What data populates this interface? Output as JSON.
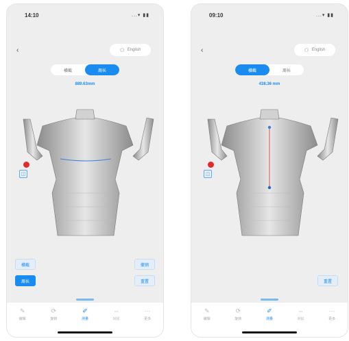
{
  "left_phone": {
    "status_time": "14:10",
    "status_icons": "...▾ ▮▮",
    "english_label": "English",
    "segments": [
      "横截",
      "周长"
    ],
    "active_segment": 1,
    "measurement": "889.63mm",
    "buttons": {
      "left_top": "横截",
      "left_bottom": "周长",
      "right_top": "撤销",
      "right_bottom": "重置"
    }
  },
  "right_phone": {
    "status_time": "09:10",
    "status_icons": "...▾ ▮▮",
    "english_label": "English",
    "segments": [
      "横截",
      "周长"
    ],
    "active_segment": 0,
    "measurement": "438.36 mm",
    "buttons": {
      "right_bottom": "重置"
    }
  },
  "tabs": [
    {
      "icon": "pencil-icon",
      "label": "编辑"
    },
    {
      "icon": "rotate-icon",
      "label": "旋转"
    },
    {
      "icon": "measure-icon",
      "label": "测量"
    },
    {
      "icon": "compare-icon",
      "label": "对比"
    },
    {
      "icon": "more-icon",
      "label": "更多"
    }
  ],
  "colors": {
    "accent": "#1a8cf0",
    "marker_red": "#e22a2a",
    "measure_line_blue": "#3a7fd8",
    "measure_line_red": "#e05050",
    "screen_bg": "#eeeeee"
  }
}
